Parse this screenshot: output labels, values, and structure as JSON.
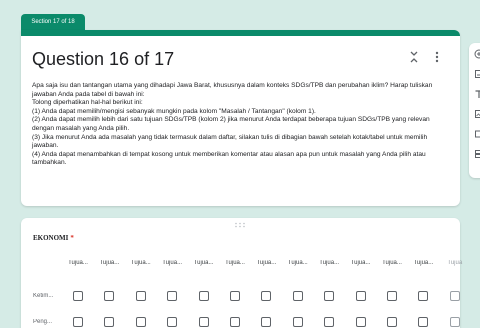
{
  "section_tab": "Section 17 of 18",
  "question": {
    "title": "Question 16 of 17",
    "icons": {
      "collapse": "collapse-vertical-icon",
      "more": "more-vert-icon"
    },
    "description": [
      "Apa saja isu dan tantangan utama yang dihadapi Jawa Barat, khususnya dalam konteks SDGs/TPB dan perubahan iklim? Harap tuliskan jawaban Anda pada tabel di bawah ini:",
      "Tolong diperhatikan hal-hal berikut ini:",
      "(1) Anda dapat memilih/mengisi sebanyak mungkin pada kolom \"Masalah / Tantangan\" (kolom 1).",
      "(2) Anda dapat memilih lebih dari satu tujuan SDGs/TPB (kolom 2) jika menurut Anda terdapat beberapa tujuan SDGs/TPB yang relevan dengan masalah yang Anda pilih.",
      "(3) Jika menurut Anda ada masalah yang tidak termasuk dalam daftar, silakan tulis di dibagian bawah setelah kotak/tabel untuk memilih jawaban.",
      "(4) Anda dapat menambahkan di tempat kosong untuk memberikan komentar atau alasan apa pun untuk masalah yang Anda pilih atau tambahkan."
    ]
  },
  "side_toolbar": [
    {
      "icon": "add-circle-icon"
    },
    {
      "icon": "import-questions-icon"
    },
    {
      "icon": "add-title-icon"
    },
    {
      "icon": "add-image-icon"
    },
    {
      "icon": "add-video-icon"
    },
    {
      "icon": "add-section-icon"
    }
  ],
  "grid_question": {
    "title": "EKONOMI",
    "required_mark": "*",
    "columns": [
      "Tujua...",
      "Tujua...",
      "Tujua...",
      "Tujua...",
      "Tujua...",
      "Tujua...",
      "Tujua...",
      "Tujua...",
      "Tujua...",
      "Tujua...",
      "Tujua...",
      "Tujua...",
      "Tujua"
    ],
    "rows": [
      "Ketim...",
      "Peng..."
    ]
  },
  "colors": {
    "background": "#d5ebe6",
    "accent": "#0b8a6a",
    "required": "#d93025"
  }
}
